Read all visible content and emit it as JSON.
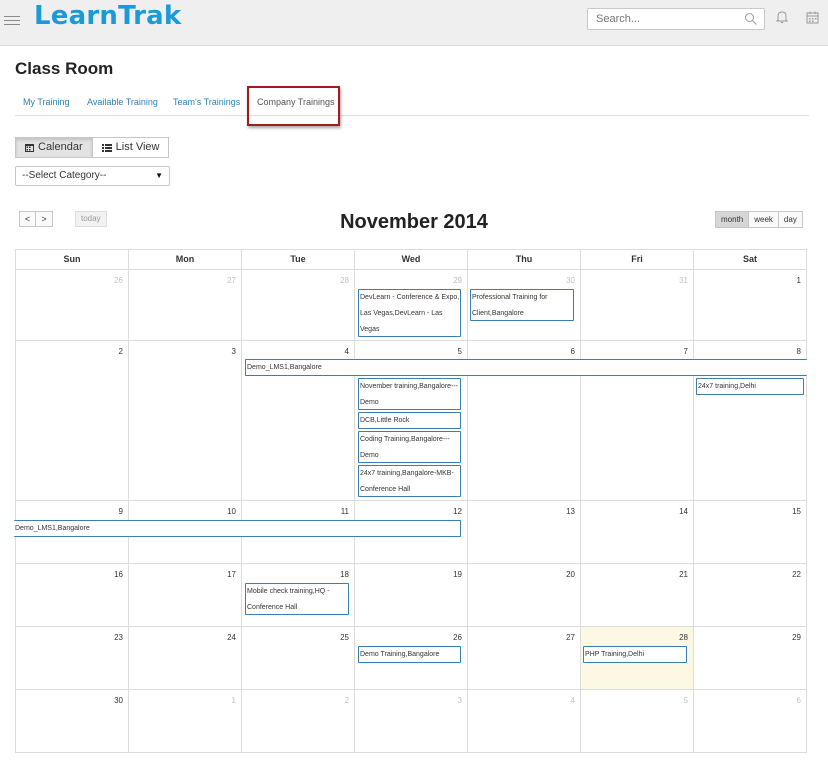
{
  "header": {
    "logo": "LearnTrak",
    "search_placeholder": "Search...",
    "icons": [
      "menu-icon",
      "search-icon",
      "bell-icon",
      "calendar-icon"
    ]
  },
  "page_title": "Class Room",
  "tabs": [
    {
      "label": "My Training"
    },
    {
      "label": "Available Training"
    },
    {
      "label": "Team's Trainings"
    },
    {
      "label": "Company Trainings",
      "active": true
    }
  ],
  "view_toggle": {
    "calendar": "Calendar",
    "list": "List View",
    "active": "calendar"
  },
  "category_select": {
    "value": "--Select Category--"
  },
  "calendar": {
    "title": "November 2014",
    "prev": "<",
    "next": ">",
    "today": "today",
    "views": [
      "month",
      "week",
      "day"
    ],
    "active_view": "month",
    "days_of_week": [
      "Sun",
      "Mon",
      "Tue",
      "Wed",
      "Thu",
      "Fri",
      "Sat"
    ],
    "weeks": [
      {
        "days": [
          "26",
          "27",
          "28",
          "29",
          "30",
          "31",
          "1"
        ]
      },
      {
        "days": [
          "2",
          "3",
          "4",
          "5",
          "6",
          "7",
          "8"
        ]
      },
      {
        "days": [
          "9",
          "10",
          "11",
          "12",
          "13",
          "14",
          "15"
        ]
      },
      {
        "days": [
          "16",
          "17",
          "18",
          "19",
          "20",
          "21",
          "22"
        ]
      },
      {
        "days": [
          "23",
          "24",
          "25",
          "26",
          "27",
          "28",
          "29"
        ]
      },
      {
        "days": [
          "30",
          "1",
          "2",
          "3",
          "4",
          "5",
          "6"
        ]
      }
    ],
    "events": {
      "devlearn": "DevLearn - Conference & Expo, Las Vegas,DevLearn - Las Vegas",
      "professional": "Professional Training for Client,Bangalore",
      "demo_lms1_w2": "Demo_LMS1,Bangalore",
      "november": "November training,Bangalore---Demo",
      "dcb": "DCB,Little Rock",
      "coding": "Coding Training,Bangalore---Demo",
      "t24x7_bangalore": "24x7 training,Bangalore-MKB-Conference Hall",
      "t24x7_delhi": "24x7 training,Delhi",
      "demo_lms1_w3": "Demo_LMS1,Bangalore",
      "mobile": "Mobile check training,HQ - Conference Hall",
      "demo_training": "Demo Training,Bangalore",
      "php": "PHP Training,Delhi"
    }
  }
}
